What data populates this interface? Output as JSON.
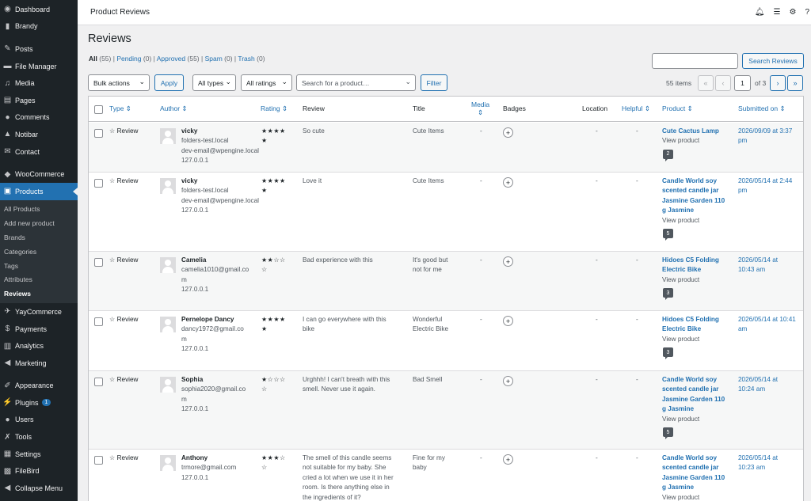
{
  "sidebar": {
    "items": [
      {
        "label": "Dashboard",
        "icon": "dashboard-icon"
      },
      {
        "label": "Brandy",
        "icon": "brandy-icon"
      },
      {
        "label": "Posts",
        "icon": "pin-icon"
      },
      {
        "label": "File Manager",
        "icon": "folder-icon"
      },
      {
        "label": "Media",
        "icon": "media-icon"
      },
      {
        "label": "Pages",
        "icon": "pages-icon"
      },
      {
        "label": "Comments",
        "icon": "comment-icon"
      },
      {
        "label": "Notibar",
        "icon": "bell-icon"
      },
      {
        "label": "Contact",
        "icon": "mail-icon"
      },
      {
        "label": "WooCommerce",
        "icon": "woo-icon"
      },
      {
        "label": "Products",
        "icon": "products-icon"
      },
      {
        "label": "YayCommerce",
        "icon": "yay-icon"
      },
      {
        "label": "Payments",
        "icon": "payments-icon"
      },
      {
        "label": "Analytics",
        "icon": "analytics-icon"
      },
      {
        "label": "Marketing",
        "icon": "marketing-icon"
      },
      {
        "label": "Appearance",
        "icon": "brush-icon"
      },
      {
        "label": "Plugins",
        "icon": "plugin-icon",
        "badge": "1"
      },
      {
        "label": "Users",
        "icon": "users-icon"
      },
      {
        "label": "Tools",
        "icon": "wrench-icon"
      },
      {
        "label": "Settings",
        "icon": "settings-icon"
      },
      {
        "label": "FileBird",
        "icon": "filebird-icon"
      },
      {
        "label": "Collapse Menu",
        "icon": "collapse-icon"
      }
    ],
    "submenu": [
      "All Products",
      "Add new product",
      "Brands",
      "Categories",
      "Tags",
      "Attributes",
      "Reviews"
    ]
  },
  "topbar": {
    "title": "Product Reviews"
  },
  "page": {
    "heading": "Reviews",
    "filters": {
      "all": "All",
      "all_count": "(55)",
      "pending": "Pending",
      "pending_count": "(0)",
      "approved": "Approved",
      "approved_count": "(55)",
      "spam": "Spam",
      "spam_count": "(0)",
      "trash": "Trash",
      "trash_count": "(0)"
    },
    "search_button": "Search Reviews",
    "bulk_actions": "Bulk actions",
    "apply": "Apply",
    "all_types": "All types",
    "all_ratings": "All ratings",
    "product_search_placeholder": "Search for a product…",
    "filter": "Filter",
    "items_count": "55 items",
    "current_page": "1",
    "total_pages": "of 3"
  },
  "table": {
    "headers": {
      "type": "Type",
      "author": "Author",
      "rating": "Rating",
      "review": "Review",
      "title": "Title",
      "media": "Media",
      "badges": "Badges",
      "location": "Location",
      "helpful": "Helpful",
      "product": "Product",
      "submitted": "Submitted on"
    },
    "rows": [
      {
        "type": "Review",
        "name": "vicky",
        "author_lines": [
          "folders-test.local",
          "dev-email@wpengine.local",
          "127.0.0.1"
        ],
        "stars_top": "★★★★",
        "stars_bottom": "★",
        "rating": 5,
        "review": [
          "So cute"
        ],
        "title": [
          "Cute Items"
        ],
        "media": "-",
        "location": "-",
        "helpful": "-",
        "product": [
          "Cute Cactus Lamp"
        ],
        "view": "View product",
        "count": "2",
        "submitted": [
          "2026/09/09 at 3:37",
          "pm"
        ]
      },
      {
        "type": "Review",
        "name": "vicky",
        "author_lines": [
          "folders-test.local",
          "dev-email@wpengine.local",
          "127.0.0.1"
        ],
        "stars_top": "★★★★",
        "stars_bottom": "★",
        "rating": 5,
        "review": [
          "Love it"
        ],
        "title": [
          "Cute Items"
        ],
        "media": "-",
        "location": "-",
        "helpful": "-",
        "product": [
          "Candle World soy",
          "scented candle jar",
          "Jasmine Garden 110",
          "g Jasmine"
        ],
        "view": "View product",
        "count": "5",
        "submitted": [
          "2026/05/14 at 2:44",
          "pm"
        ]
      },
      {
        "type": "Review",
        "name": "Camelia",
        "author_lines": [
          "camelia1010@gmail.co",
          "m",
          "127.0.0.1"
        ],
        "stars_top": "★★☆☆",
        "stars_bottom": "☆",
        "rating": 2,
        "review": [
          "Bad experience with this"
        ],
        "title": [
          "It's good but",
          "not for me"
        ],
        "media": "-",
        "location": "-",
        "helpful": "-",
        "product": [
          "Hidoes C5 Folding",
          "Electric Bike"
        ],
        "view": "View product",
        "count": "3",
        "submitted": [
          "2026/05/14 at",
          "10:43 am"
        ]
      },
      {
        "type": "Review",
        "name": "Pernelope Dancy",
        "author_lines": [
          "dancy1972@gmail.co",
          "m",
          "127.0.0.1"
        ],
        "stars_top": "★★★★",
        "stars_bottom": "★",
        "rating": 5,
        "review": [
          "I can go everywhere with this",
          "bike"
        ],
        "title": [
          "Wonderful",
          "Electric Bike"
        ],
        "media": "-",
        "location": "-",
        "helpful": "-",
        "product": [
          "Hidoes C5 Folding",
          "Electric Bike"
        ],
        "view": "View product",
        "count": "3",
        "submitted": [
          "2026/05/14 at 10:41",
          "am"
        ]
      },
      {
        "type": "Review",
        "name": "Sophia",
        "author_lines": [
          "sophia2020@gmail.co",
          "m",
          "127.0.0.1"
        ],
        "stars_top": "★☆☆☆",
        "stars_bottom": "☆",
        "rating": 1,
        "review": [
          "Urghhh! I can't breath with this",
          "smell. Never use it again."
        ],
        "title": [
          "Bad Smell"
        ],
        "media": "-",
        "location": "-",
        "helpful": "-",
        "product": [
          "Candle World soy",
          "scented candle jar",
          "Jasmine Garden 110",
          "g Jasmine"
        ],
        "view": "View product",
        "count": "5",
        "submitted": [
          "2026/05/14 at",
          "10:24 am"
        ]
      },
      {
        "type": "Review",
        "name": "Anthony",
        "author_lines": [
          "trmore@gmail.com",
          "127.0.0.1"
        ],
        "stars_top": "★★★☆",
        "stars_bottom": "☆",
        "rating": 3,
        "review": [
          "The smell of this candle seems",
          "not suitable for my baby. She",
          "cried a lot when we use it in her",
          "room. Is there anything else in",
          "the ingredients of it?"
        ],
        "title": [
          "Fine for my",
          "baby"
        ],
        "media": "-",
        "location": "-",
        "helpful": "-",
        "product": [
          "Candle World soy",
          "scented candle jar",
          "Jasmine Garden 110",
          "g Jasmine"
        ],
        "view": "View product",
        "count": "",
        "submitted": [
          "2026/05/14 at",
          "10:23 am"
        ]
      }
    ]
  }
}
